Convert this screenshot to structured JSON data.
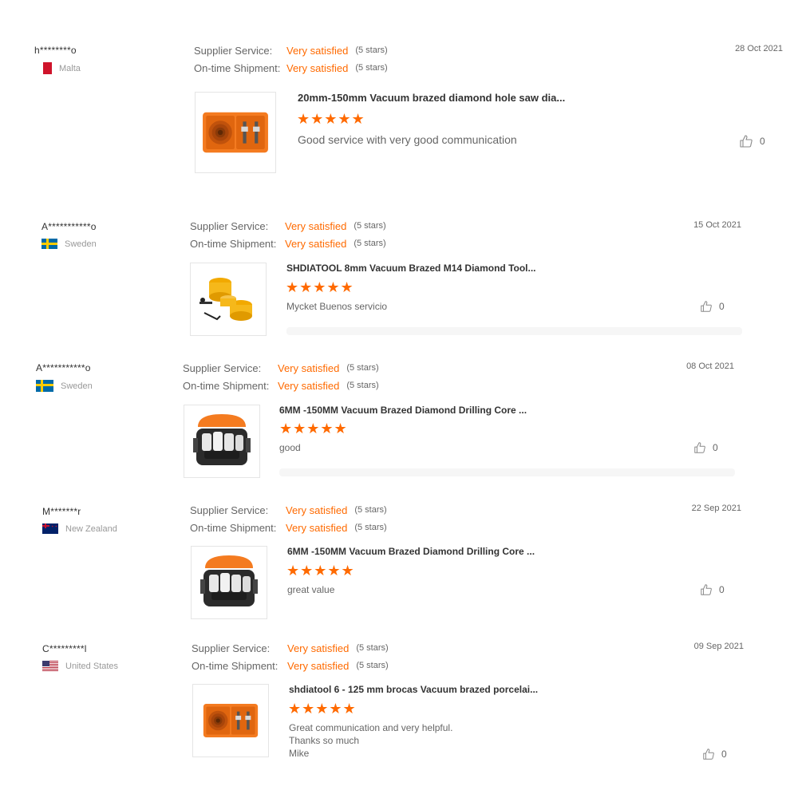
{
  "ratings_labels": {
    "supplier": "Supplier Service:",
    "shipment": "On-time Shipment:"
  },
  "reviews": [
    {
      "user": "h********o",
      "country": "Malta",
      "flag": "mt",
      "supplier_rating": "Very satisfied",
      "supplier_stars": "(5 stars)",
      "shipment_rating": "Very satisfied",
      "shipment_stars": "(5 stars)",
      "date": "28 Oct 2021",
      "product_title": "20mm-150mm Vacuum brazed diamond hole saw dia...",
      "product_icon": "hole-saw-kit-case",
      "stars": "★★★★★",
      "comment": "Good service with very good communication",
      "likes": "0"
    },
    {
      "user": "A***********o",
      "country": "Sweden",
      "flag": "se",
      "supplier_rating": "Very satisfied",
      "supplier_stars": "(5 stars)",
      "shipment_rating": "Very satisfied",
      "shipment_stars": "(5 stars)",
      "date": "15 Oct 2021",
      "product_title": "SHDIATOOL 8mm Vacuum Brazed M14 Diamond Tool...",
      "product_icon": "yellow-hole-saws",
      "stars": "★★★★★",
      "comment": "Mycket Buenos servicio",
      "likes": "0"
    },
    {
      "user": "A***********o",
      "country": "Sweden",
      "flag": "se",
      "supplier_rating": "Very satisfied",
      "supplier_stars": "(5 stars)",
      "shipment_rating": "Very satisfied",
      "shipment_stars": "(5 stars)",
      "date": "08 Oct 2021",
      "product_title": "6MM -150MM Vacuum Brazed Diamond Drilling Core ...",
      "product_icon": "core-bit-case",
      "stars": "★★★★★",
      "comment": "good",
      "likes": "0"
    },
    {
      "user": "M*******r",
      "country": "New Zealand",
      "flag": "nz",
      "supplier_rating": "Very satisfied",
      "supplier_stars": "(5 stars)",
      "shipment_rating": "Very satisfied",
      "shipment_stars": "(5 stars)",
      "date": "22 Sep 2021",
      "product_title": "6MM -150MM Vacuum Brazed Diamond Drilling Core ...",
      "product_icon": "core-bit-case",
      "stars": "★★★★★",
      "comment": "great value",
      "likes": "0"
    },
    {
      "user": "C*********l",
      "country": "United States",
      "flag": "us",
      "supplier_rating": "Very satisfied",
      "supplier_stars": "(5 stars)",
      "shipment_rating": "Very satisfied",
      "shipment_stars": "(5 stars)",
      "date": "09 Sep 2021",
      "product_title": "shdiatool 6 - 125 mm brocas Vacuum brazed porcelai...",
      "product_icon": "hole-saw-kit-case",
      "stars": "★★★★★",
      "comment_lines": [
        "Great communication and very helpful.",
        "Thanks so much",
        "Mike"
      ],
      "likes": "0"
    }
  ]
}
